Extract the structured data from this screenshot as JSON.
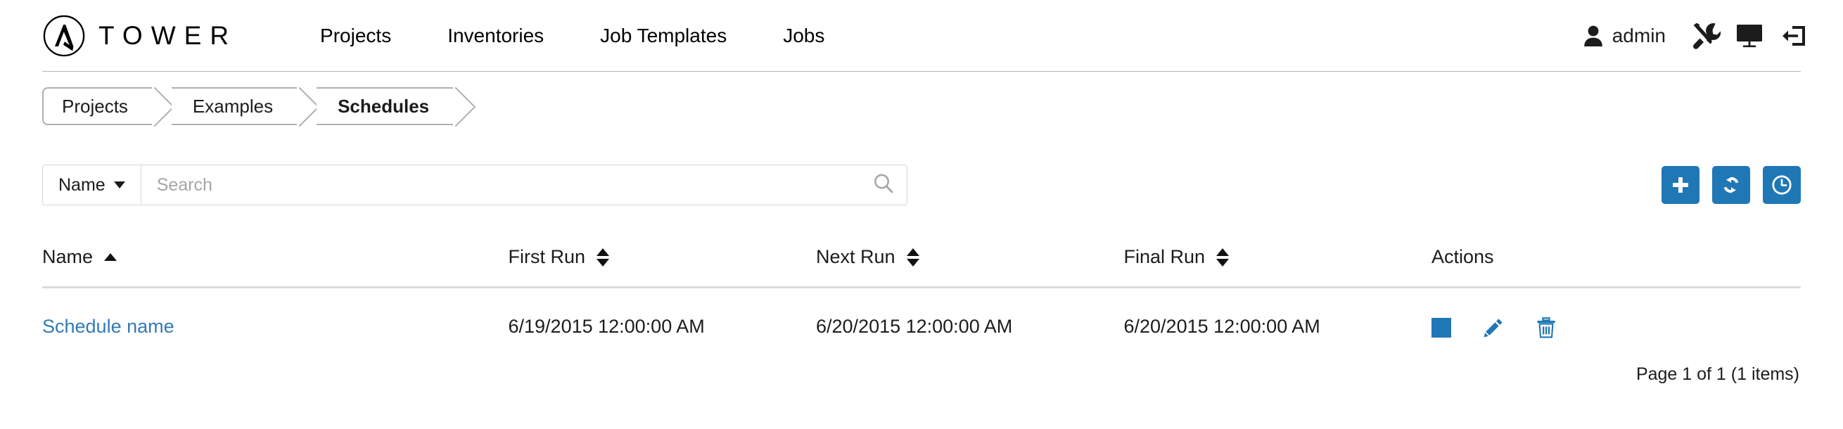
{
  "header": {
    "brand_name": "TOWER",
    "logo_icon": "ansible-tower-logo-icon",
    "nav": [
      {
        "label": "Projects",
        "name": "projects"
      },
      {
        "label": "Inventories",
        "name": "inventories"
      },
      {
        "label": "Job Templates",
        "name": "job-templates"
      },
      {
        "label": "Jobs",
        "name": "jobs"
      }
    ],
    "user": {
      "name": "admin",
      "icon": "user-icon"
    },
    "icons": [
      {
        "name": "settings-tools-icon",
        "title": "Settings"
      },
      {
        "name": "monitor-screen-icon",
        "title": "View"
      },
      {
        "name": "logout-icon",
        "title": "Log out"
      }
    ]
  },
  "breadcrumb": {
    "items": [
      {
        "label": "Projects",
        "current": false
      },
      {
        "label": "Examples",
        "current": false
      },
      {
        "label": "Schedules",
        "current": true
      }
    ]
  },
  "search": {
    "key_label": "Name",
    "key_caret_icon": "chevron-down-icon",
    "placeholder": "Search",
    "value": "",
    "submit_icon": "search-icon"
  },
  "toolbar": {
    "buttons": [
      {
        "name": "add-button",
        "icon": "plus-icon"
      },
      {
        "name": "refresh-button",
        "icon": "refresh-icon"
      },
      {
        "name": "schedule-button",
        "icon": "clock-icon"
      }
    ],
    "accent_color": "#2077b6"
  },
  "table": {
    "columns": [
      {
        "label": "Name",
        "sort": "asc"
      },
      {
        "label": "First Run",
        "sort": "both"
      },
      {
        "label": "Next Run",
        "sort": "both"
      },
      {
        "label": "Final Run",
        "sort": "both"
      },
      {
        "label": "Actions",
        "sort": "none"
      }
    ],
    "rows": [
      {
        "name": "Schedule name",
        "first_run": "6/19/2015 12:00:00 AM",
        "next_run": "6/20/2015 12:00:00 AM",
        "final_run": "6/20/2015 12:00:00 AM",
        "actions": [
          {
            "name": "toggle-stop-action",
            "icon": "stop-square-icon"
          },
          {
            "name": "edit-action",
            "icon": "pencil-icon"
          },
          {
            "name": "delete-action",
            "icon": "trash-icon"
          }
        ]
      }
    ]
  },
  "pagination": {
    "text": "Page 1 of 1 (1 items)"
  },
  "colors": {
    "accent_blue": "#2077b6",
    "link_blue": "#337ab7",
    "border_gray": "#d7d7d7"
  }
}
